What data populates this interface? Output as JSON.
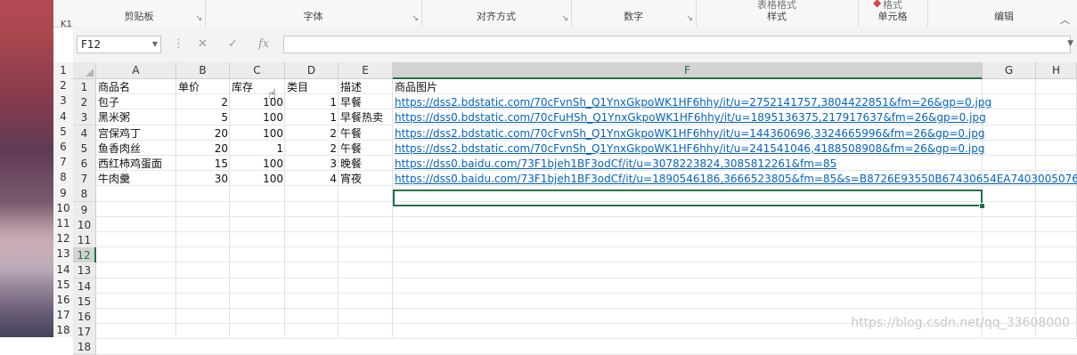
{
  "ribbon": {
    "groups": [
      {
        "label": "剪贴板"
      },
      {
        "label": "字体"
      },
      {
        "label": "对齐方式"
      },
      {
        "label": "数字"
      },
      {
        "label": "样式",
        "fragment": "表格格式"
      },
      {
        "label": "单元格",
        "fragment": "格式"
      },
      {
        "label": "编辑"
      }
    ],
    "collapse_icon": "chevron-up-icon"
  },
  "formula_bar": {
    "namebox": "F12",
    "peek_text": "K1",
    "formula": "",
    "icons": [
      "more-icon",
      "cancel-icon",
      "enter-icon",
      "fx-icon"
    ]
  },
  "sheet": {
    "columns": [
      "A",
      "B",
      "C",
      "D",
      "E",
      "F",
      "G",
      "H"
    ],
    "selected_column": "F",
    "rows": [
      "1",
      "2",
      "3",
      "4",
      "5",
      "6",
      "7",
      "8",
      "9",
      "10",
      "11",
      "12",
      "13",
      "14",
      "15",
      "16",
      "17",
      "18"
    ],
    "selected_row": "12",
    "back_rows": [
      "1",
      "2",
      "3",
      "4",
      "5",
      "6",
      "7",
      "8",
      "9",
      "10",
      "11",
      "12",
      "13",
      "14",
      "15",
      "16",
      "17",
      "18"
    ],
    "headers": [
      "商品名",
      "单价",
      "库存",
      "类目",
      "描述",
      "商品图片"
    ],
    "data": [
      [
        "包子",
        "2",
        "100",
        "1",
        "早餐",
        "https://dss2.bdstatic.com/70cFvnSh_Q1YnxGkpoWK1HF6hhy/it/u=2752141757,3804422851&fm=26&gp=0.jpg"
      ],
      [
        "黑米粥",
        "5",
        "100",
        "1",
        "早餐热卖",
        "https://dss0.bdstatic.com/70cFuHSh_Q1YnxGkpoWK1HF6hhy/it/u=1895136375,217917637&fm=26&gp=0.jpg"
      ],
      [
        "宫保鸡丁",
        "20",
        "100",
        "2",
        "午餐",
        "https://dss2.bdstatic.com/70cFvnSh_Q1YnxGkpoWK1HF6hhy/it/u=144360696,3324665996&fm=26&gp=0.jpg"
      ],
      [
        "鱼香肉丝",
        "20",
        "1",
        "2",
        "午餐",
        "https://dss2.bdstatic.com/70cFvnSh_Q1YnxGkpoWK1HF6hhy/it/u=241541046,4188508908&fm=26&gp=0.jpg"
      ],
      [
        "西红柿鸡蛋面",
        "15",
        "100",
        "3",
        "晚餐",
        "https://dss0.baidu.com/73F1bjeh1BF3odCf/it/u=3078223824,3085812261&fm=85"
      ],
      [
        "牛肉羹",
        "30",
        "100",
        "4",
        "宵夜",
        "https://dss0.baidu.com/73F1bjeh1BF3odCf/it/u=1890546186,3666523805&fm=85&s=B8726E93550B67430654EA7403005076"
      ]
    ]
  },
  "watermark": "https://blog.csdn.net/qq_33608000",
  "colors": {
    "excel_green": "#217346",
    "link_blue": "#0563c1"
  }
}
